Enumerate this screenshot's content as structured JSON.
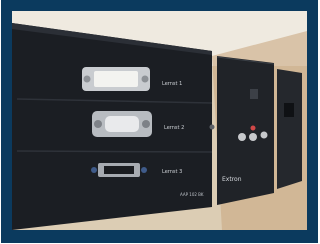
{
  "image": {
    "description_kind": "photo",
    "panel_labels": {
      "row1": "Lernst 1",
      "row2": "Lernst 2",
      "row3": "Lernst 3",
      "brand": "Extron",
      "model": "AAP 102 BK"
    }
  },
  "colors": {
    "frame": "#0b3a5e",
    "panel": "#1c1f24",
    "wood": "#d3c2a5"
  }
}
